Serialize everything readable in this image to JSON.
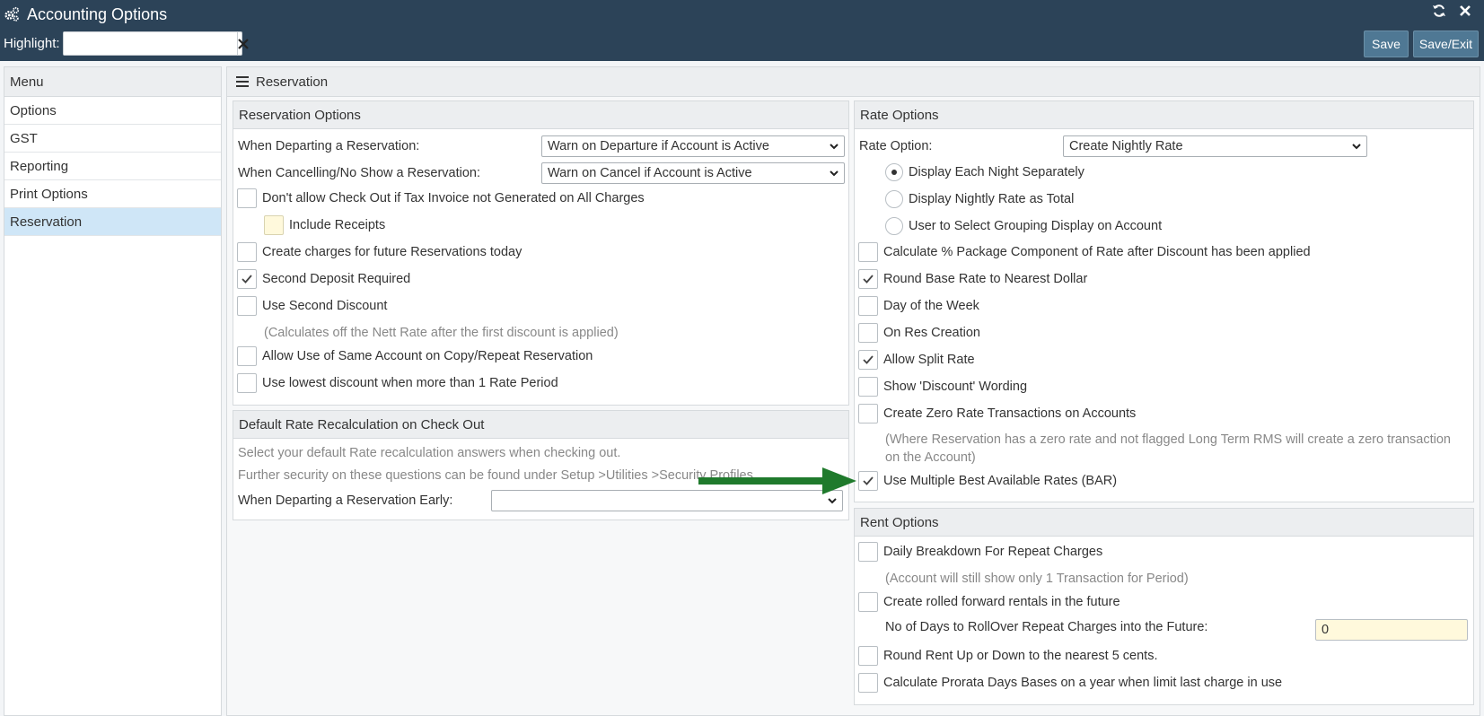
{
  "window": {
    "title": "Accounting Options",
    "icon": "gears-icon"
  },
  "toolbar": {
    "highlight_label": "Highlight:",
    "highlight_value": "",
    "save_label": "Save",
    "save_exit_label": "Save/Exit"
  },
  "menu": {
    "header": "Menu",
    "items": [
      {
        "label": "Options"
      },
      {
        "label": "GST"
      },
      {
        "label": "Reporting"
      },
      {
        "label": "Print Options"
      },
      {
        "label": "Reservation",
        "active": true
      }
    ]
  },
  "main": {
    "header": "Reservation"
  },
  "reservation_options": {
    "title": "Reservation Options",
    "departing_label": "When Departing a Reservation:",
    "departing_value": "Warn on Departure if Account is Active",
    "cancelling_label": "When Cancelling/No Show a Reservation:",
    "cancelling_value": "Warn on Cancel if Account is Active",
    "checkboxes": [
      {
        "label": "Don't allow Check Out if Tax Invoice not Generated on All Charges",
        "checked": false
      },
      {
        "label": "Include Receipts",
        "checked": false
      },
      {
        "label": "Create charges for future Reservations today",
        "checked": false
      },
      {
        "label": "Second Deposit Required",
        "checked": true
      },
      {
        "label": "Use Second Discount",
        "checked": false
      },
      {
        "label": "Allow Use of Same Account on Copy/Repeat Reservation",
        "checked": false
      },
      {
        "label": "Use lowest discount when more than 1 Rate Period",
        "checked": false
      }
    ],
    "second_discount_note": "(Calculates off the Nett Rate after the first discount is applied)"
  },
  "default_rate": {
    "title": "Default Rate Recalculation on Check Out",
    "note1": "Select your default Rate recalculation answers when checking out.",
    "note2": "Further security on these questions can be found under Setup >Utilities >Security Profiles",
    "early_label": "When Departing a Reservation Early:",
    "early_value": ""
  },
  "rate_options": {
    "title": "Rate Options",
    "rate_option_label": "Rate Option:",
    "rate_option_value": "Create Nightly Rate",
    "radios": [
      {
        "label": "Display Each Night Separately",
        "selected": true
      },
      {
        "label": "Display Nightly Rate as Total",
        "selected": false
      },
      {
        "label": "User to Select Grouping Display on Account",
        "selected": false
      }
    ],
    "checkboxes": [
      {
        "label": "Calculate % Package Component of Rate after Discount has been applied",
        "checked": false
      },
      {
        "label": "Round Base Rate to Nearest Dollar",
        "checked": true
      },
      {
        "label": "Day of the Week",
        "checked": false
      },
      {
        "label": "On Res Creation",
        "checked": false
      },
      {
        "label": "Allow Split Rate",
        "checked": true
      },
      {
        "label": "Show 'Discount' Wording",
        "checked": false
      },
      {
        "label": "Create Zero Rate Transactions on Accounts",
        "checked": false
      },
      {
        "label": "Use Multiple Best Available Rates (BAR)",
        "checked": true
      }
    ],
    "zero_rate_note_line1": "(Where Reservation has a zero rate and not flagged Long Term RMS will create a zero transaction",
    "zero_rate_note_line2": "on the Account)"
  },
  "rent_options": {
    "title": "Rent Options",
    "checkboxes": [
      {
        "label": "Daily Breakdown For Repeat Charges",
        "checked": false
      },
      {
        "label": "Create rolled forward rentals in the future",
        "checked": false
      },
      {
        "label": "Round Rent Up or Down to the nearest 5 cents.",
        "checked": false
      },
      {
        "label": "Calculate Prorata Days Bases on a year when limit last charge in use",
        "checked": false
      }
    ],
    "breakdown_note": "(Account will still show only 1 Transaction for Period)",
    "rollover_label": "No of Days to RollOver Repeat Charges into the Future:",
    "rollover_value": "0"
  },
  "colors": {
    "titlebar": "#2c4358",
    "active_menu": "#cfe6f7",
    "button": "#4f7894",
    "annotation_arrow": "#1f7a2c"
  }
}
